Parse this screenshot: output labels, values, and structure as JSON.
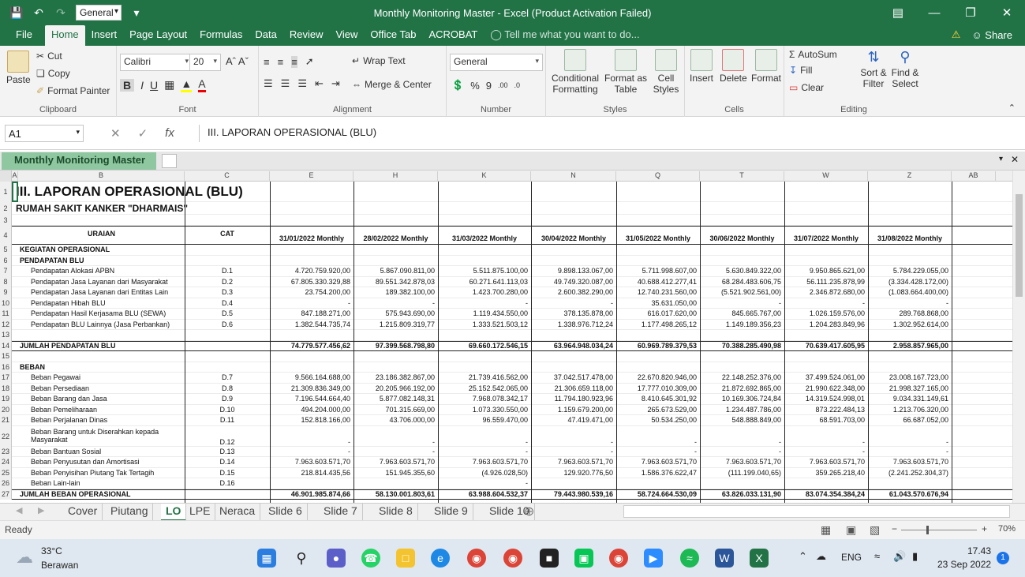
{
  "window": {
    "title": "Monthly Monitoring Master - Excel (Product Activation Failed)",
    "format_box": "General"
  },
  "menu": {
    "tabs": [
      "File",
      "Home",
      "Insert",
      "Page Layout",
      "Formulas",
      "Data",
      "Review",
      "View",
      "Office Tab",
      "ACROBAT"
    ],
    "tell_me": "Tell me what you want to do...",
    "share": "Share"
  },
  "ribbon": {
    "clipboard": {
      "paste": "Paste",
      "cut": "Cut",
      "copy": "Copy",
      "format_painter": "Format Painter",
      "label": "Clipboard"
    },
    "font": {
      "name": "Calibri",
      "size": "20",
      "label": "Font"
    },
    "alignment": {
      "wrap": "Wrap Text",
      "merge": "Merge & Center",
      "label": "Alignment"
    },
    "number": {
      "format": "General",
      "label": "Number"
    },
    "styles": {
      "cond": "Conditional Formatting",
      "fmt_table": "Format as Table",
      "cell_styles": "Cell Styles",
      "label": "Styles"
    },
    "cells": {
      "insert": "Insert",
      "delete": "Delete",
      "format": "Format",
      "label": "Cells"
    },
    "editing": {
      "autosum": "AutoSum",
      "fill": "Fill",
      "clear": "Clear",
      "sort": "Sort & Filter",
      "find": "Find & Select",
      "label": "Editing"
    }
  },
  "formula_bar": {
    "cell": "A1",
    "content": "III. LAPORAN OPERASIONAL (BLU)"
  },
  "workbook_tab": "Monthly Monitoring Master",
  "columns": [
    "A",
    "B",
    "C",
    "E",
    "H",
    "K",
    "N",
    "Q",
    "T",
    "W",
    "Z",
    "AB"
  ],
  "sheet": {
    "title": "III. LAPORAN OPERASIONAL (BLU)",
    "subtitle": "RUMAH SAKIT KANKER \"DHARMAIS\"",
    "header": {
      "uraian": "URAIAN",
      "cat": "CAT",
      "months": [
        "31/01/2022 Monthly",
        "28/02/2022 Monthly",
        "31/03/2022 Monthly",
        "30/04/2022 Monthly",
        "31/05/2022 Monthly",
        "30/06/2022 Monthly",
        "31/07/2022 Monthly",
        "31/08/2022 Monthly"
      ]
    },
    "rows": [
      {
        "r": "5",
        "label": "KEGIATAN OPERASIONAL",
        "bold": true,
        "cat": "",
        "v": [
          "",
          "",
          "",
          "",
          "",
          "",
          "",
          ""
        ]
      },
      {
        "r": "6",
        "label": "PENDAPATAN  BLU",
        "bold": true,
        "cat": "",
        "v": [
          "",
          "",
          "",
          "",
          "",
          "",
          "",
          ""
        ]
      },
      {
        "r": "7",
        "label": "Pendapatan Alokasi APBN",
        "ind": true,
        "cat": "D.1",
        "v": [
          "4.720.759.920,00",
          "5.867.090.811,00",
          "5.511.875.100,00",
          "9.898.133.067,00",
          "5.711.998.607,00",
          "5.630.849.322,00",
          "9.950.865.621,00",
          "5.784.229.055,00"
        ]
      },
      {
        "r": "8",
        "label": "Pendapatan Jasa Layanan dari Masyarakat",
        "ind": true,
        "cat": "D.2",
        "v": [
          "67.805.330.329,88",
          "89.551.342.878,03",
          "60.271.641.113,03",
          "49.749.320.087,00",
          "40.688.412.277,41",
          "68.284.483.606,75",
          "56.111.235.878,99",
          "(3.334.428.172,00)"
        ]
      },
      {
        "r": "9",
        "label": "Pendapatan Jasa Layanan dari Entitas Lain",
        "ind": true,
        "cat": "D.3",
        "v": [
          "23.754.200,00",
          "189.382.100,00",
          "1.423.700.280,00",
          "2.600.382.290,00",
          "12.740.231.560,00",
          "(5.521.902.561,00)",
          "2.346.872.680,00",
          "(1.083.664.400,00)"
        ]
      },
      {
        "r": "10",
        "label": "Pendapatan Hibah BLU",
        "ind": true,
        "cat": "D.4",
        "v": [
          "-",
          "-",
          "-",
          "-",
          "35.631.050,00",
          "-",
          "-",
          "-"
        ]
      },
      {
        "r": "11",
        "label": "Pendapatan Hasil Kerjasama BLU (SEWA)",
        "ind": true,
        "cat": "D.5",
        "v": [
          "847.188.271,00",
          "575.943.690,00",
          "1.119.434.550,00",
          "378.135.878,00",
          "616.017.620,00",
          "845.665.767,00",
          "1.026.159.576,00",
          "289.768.868,00"
        ]
      },
      {
        "r": "12",
        "label": "Pendapatan BLU Lainnya (Jasa Perbankan)",
        "ind": true,
        "cat": "D.6",
        "v": [
          "1.382.544.735,74",
          "1.215.809.319,77",
          "1.333.521.503,12",
          "1.338.976.712,24",
          "1.177.498.265,12",
          "1.149.189.356,23",
          "1.204.283.849,96",
          "1.302.952.614,00"
        ]
      },
      {
        "r": "13",
        "label": "",
        "cat": "",
        "v": [
          "",
          "",
          "",
          "",
          "",
          "",
          "",
          ""
        ]
      },
      {
        "r": "14",
        "label": "JUMLAH PENDAPATAN BLU",
        "bold": true,
        "cat": "",
        "total": true,
        "v": [
          "74.779.577.456,62",
          "97.399.568.798,80",
          "69.660.172.546,15",
          "63.964.948.034,24",
          "60.969.789.379,53",
          "70.388.285.490,98",
          "70.639.417.605,95",
          "2.958.857.965,00"
        ]
      },
      {
        "r": "15",
        "label": "",
        "cat": "",
        "v": [
          "",
          "",
          "",
          "",
          "",
          "",
          "",
          ""
        ]
      },
      {
        "r": "16",
        "label": "BEBAN",
        "bold": true,
        "cat": "",
        "v": [
          "",
          "",
          "",
          "",
          "",
          "",
          "",
          ""
        ]
      },
      {
        "r": "17",
        "label": "Beban Pegawai",
        "ind": true,
        "cat": "D.7",
        "v": [
          "9.566.164.688,00",
          "23.186.382.867,00",
          "21.739.416.562,00",
          "37.042.517.478,00",
          "22.670.820.946,00",
          "22.148.252.376,00",
          "37.499.524.061,00",
          "23.008.167.723,00"
        ]
      },
      {
        "r": "18",
        "label": "Beban Persediaan",
        "ind": true,
        "cat": "D.8",
        "v": [
          "21.309.836.349,00",
          "20.205.966.192,00",
          "25.152.542.065,00",
          "21.306.659.118,00",
          "17.777.010.309,00",
          "21.872.692.865,00",
          "21.990.622.348,00",
          "21.998.327.165,00"
        ]
      },
      {
        "r": "19",
        "label": "Beban Barang dan Jasa",
        "ind": true,
        "cat": "D.9",
        "v": [
          "7.196.544.664,40",
          "5.877.082.148,31",
          "7.968.078.342,17",
          "11.794.180.923,96",
          "8.410.645.301,92",
          "10.169.306.724,84",
          "14.319.524.998,01",
          "9.034.331.149,61"
        ]
      },
      {
        "r": "20",
        "label": "Beban Pemeliharaan",
        "ind": true,
        "cat": "D.10",
        "v": [
          "494.204.000,00",
          "701.315.669,00",
          "1.073.330.550,00",
          "1.159.679.200,00",
          "265.673.529,00",
          "1.234.487.786,00",
          "873.222.484,13",
          "1.213.706.320,00"
        ]
      },
      {
        "r": "21",
        "label": "Beban Perjalanan Dinas",
        "ind": true,
        "cat": "D.11",
        "v": [
          "152.818.166,00",
          "43.706.000,00",
          "96.559.470,00",
          "47.419.471,00",
          "50.534.250,00",
          "548.888.849,00",
          "68.591.703,00",
          "66.687.052,00"
        ]
      },
      {
        "r": "22",
        "label": "Beban Barang untuk Diserahkan kepada",
        "label2": "Masyarakat",
        "ind": true,
        "tall": true,
        "cat": "D.12",
        "v": [
          "-",
          "-",
          "-",
          "-",
          "-",
          "-",
          "-",
          "-"
        ]
      },
      {
        "r": "23",
        "label": "Beban Bantuan Sosial",
        "ind": true,
        "cat": "D.13",
        "v": [
          "-",
          "-",
          "-",
          "-",
          "-",
          "-",
          "-",
          "-"
        ]
      },
      {
        "r": "24",
        "label": "Beban Penyusutan dan Amortisasi",
        "ind": true,
        "cat": "D.14",
        "v": [
          "7.963.603.571,70",
          "7.963.603.571,70",
          "7.963.603.571,70",
          "7.963.603.571,70",
          "7.963.603.571,70",
          "7.963.603.571,70",
          "7.963.603.571,70",
          "7.963.603.571,70"
        ]
      },
      {
        "r": "25",
        "label": "Beban Penyisihan Piutang Tak Tertagih",
        "ind": true,
        "cat": "D.15",
        "v": [
          "218.814.435,56",
          "151.945.355,60",
          "(4.926.028,50)",
          "129.920.776,50",
          "1.586.376.622,47",
          "(111.199.040,65)",
          "359.265.218,40",
          "(2.241.252.304,37)"
        ]
      },
      {
        "r": "26",
        "label": "Beban Lain-lain",
        "ind": true,
        "cat": "D.16",
        "v": [
          "",
          "",
          "-",
          "",
          "",
          "",
          "",
          ""
        ]
      },
      {
        "r": "27",
        "label": "JUMLAH BEBAN OPERASIONAL",
        "bold": true,
        "cat": "",
        "total": true,
        "v": [
          "46.901.985.874,66",
          "58.130.001.803,61",
          "63.988.604.532,37",
          "79.443.980.539,16",
          "58.724.664.530,09",
          "63.826.033.131,90",
          "83.074.354.384,24",
          "61.043.570.676,94"
        ]
      }
    ]
  },
  "sheet_tabs": [
    "Cover",
    "Piutang",
    "LO",
    "LPE",
    "Neraca",
    "Slide 6",
    "Slide 7",
    "Slide 8",
    "Slide 9",
    "Slide 10"
  ],
  "active_sheet": "LO",
  "status": {
    "ready": "Ready",
    "zoom": "70%"
  },
  "taskbar": {
    "temp": "33°C",
    "weather": "Berawan",
    "lang": "ENG",
    "time": "17.43",
    "date": "23 Sep 2022",
    "notif": "1"
  }
}
